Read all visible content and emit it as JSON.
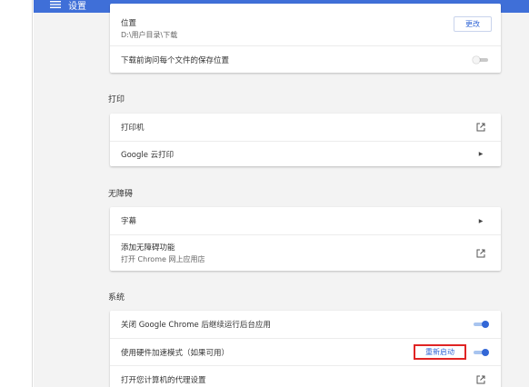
{
  "header": {
    "title": "设置"
  },
  "download": {
    "location_label": "位置",
    "location_path": "D:\\用户目录\\下载",
    "change_button": "更改",
    "ask_label": "下载前询问每个文件的保存位置",
    "ask_enabled": false
  },
  "print": {
    "title": "打印",
    "printer_label": "打印机",
    "cloud_print_label": "Google 云打印"
  },
  "accessibility": {
    "title": "无障碍",
    "captions_label": "字幕",
    "add_features_label": "添加无障碍功能",
    "add_features_sub": "打开 Chrome 网上应用店"
  },
  "system": {
    "title": "系统",
    "background_label": "关闭 Google Chrome 后继续运行后台应用",
    "background_enabled": true,
    "hw_accel_label": "使用硬件加速模式（如果可用）",
    "relaunch_button": "重新启动",
    "hw_accel_enabled": true,
    "proxy_label": "打开您计算机的代理设置"
  },
  "icons": {
    "menu": "menu-icon",
    "external": "external-link-icon",
    "chevron": "chevron-right-icon"
  },
  "colors": {
    "topbar": "#3f6fd8",
    "accent": "#3367d6",
    "highlight_border": "#e02424",
    "background": "#f3f3f3"
  }
}
